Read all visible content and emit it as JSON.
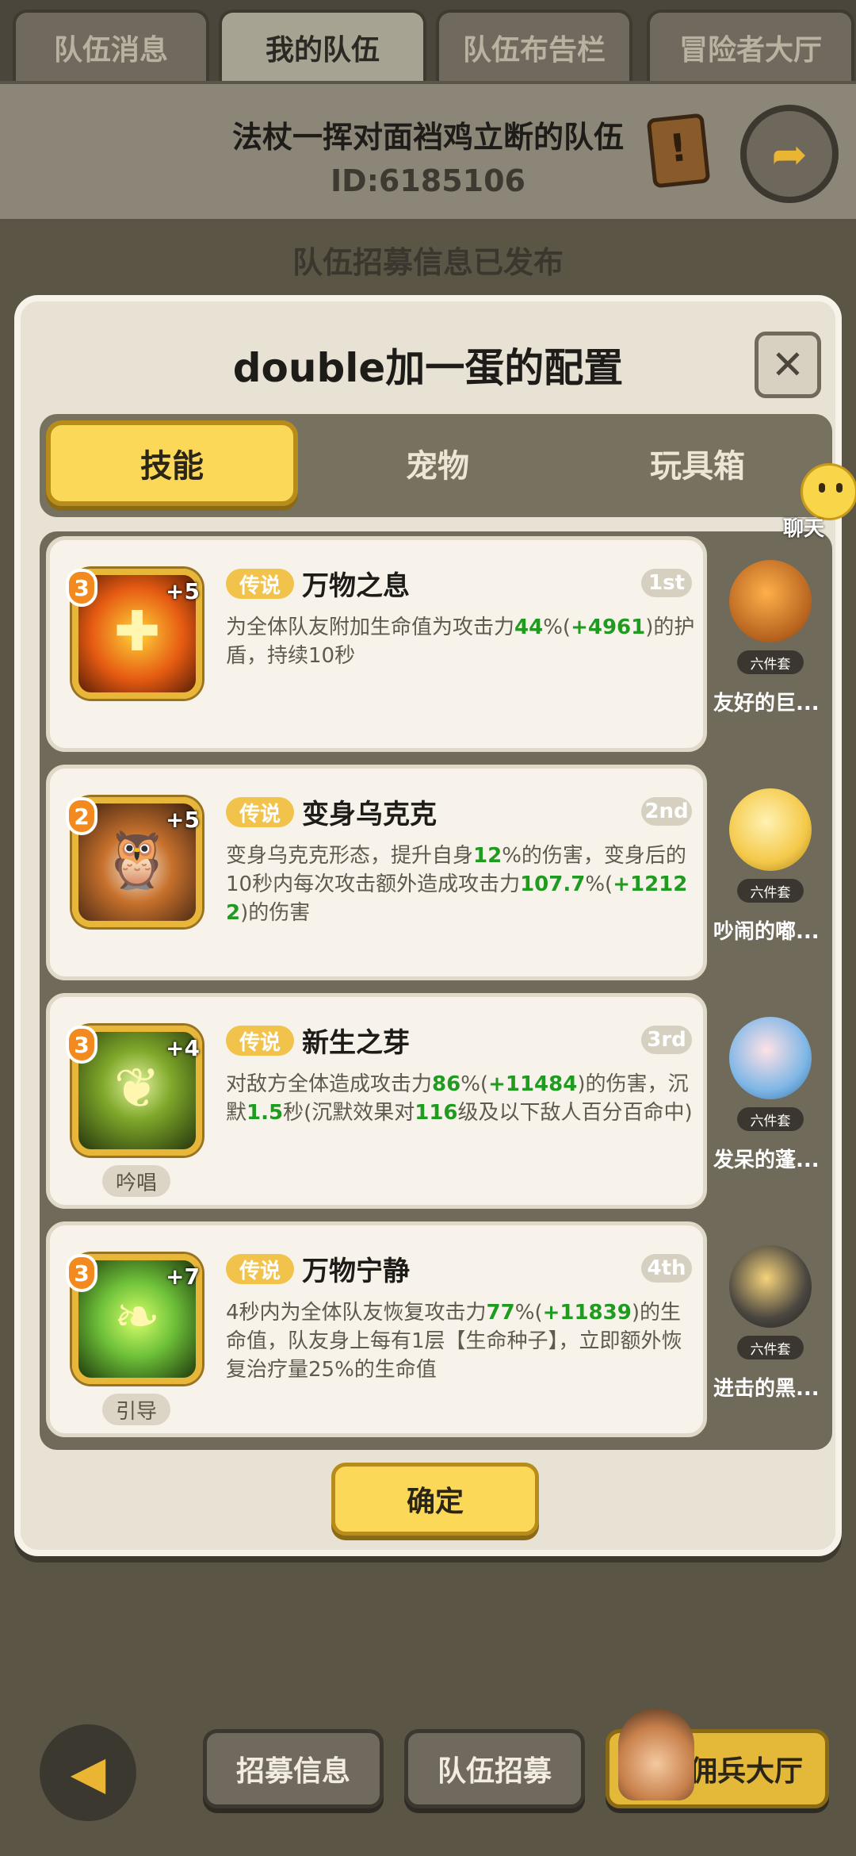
{
  "top_tabs": [
    "队伍消息",
    "我的队伍",
    "队伍布告栏",
    "冒险者大厅"
  ],
  "team": {
    "name": "法杖一挥对面裆鸡立断的队伍",
    "id": "ID:6185106"
  },
  "recruit_status": "队伍招募信息已发布",
  "modal": {
    "title": "double加一蛋的配置",
    "close_symbol": "✕",
    "tabs": [
      "技能",
      "宠物",
      "玩具箱"
    ],
    "active_tab": "技能",
    "confirm_label": "确定"
  },
  "skills": [
    {
      "rarity": "传说",
      "name": "万物之息",
      "rank": "1st",
      "level": "3",
      "plus": "+5",
      "tag": "",
      "desc": [
        {
          "t": "为全体队友附加生命值为攻击力"
        },
        {
          "t": "44",
          "g": true
        },
        {
          "t": "%("
        },
        {
          "t": "+4961",
          "g": true
        },
        {
          "t": ")的护盾，持续10秒"
        }
      ]
    },
    {
      "rarity": "传说",
      "name": "变身乌克克",
      "rank": "2nd",
      "level": "2",
      "plus": "+5",
      "tag": "",
      "desc": [
        {
          "t": "变身乌克克形态，提升自身"
        },
        {
          "t": "12",
          "g": true
        },
        {
          "t": "%的伤害，变身后的10秒内每次攻击额外造成攻击力"
        },
        {
          "t": "107.7",
          "g": true
        },
        {
          "t": "%("
        },
        {
          "t": "+12122",
          "g": true
        },
        {
          "t": ")的伤害"
        }
      ]
    },
    {
      "rarity": "传说",
      "name": "新生之芽",
      "rank": "3rd",
      "level": "3",
      "plus": "+4",
      "tag": "吟唱",
      "desc": [
        {
          "t": "对敌方全体造成攻击力"
        },
        {
          "t": "86",
          "g": true
        },
        {
          "t": "%("
        },
        {
          "t": "+11484",
          "g": true
        },
        {
          "t": ")的伤害，沉默"
        },
        {
          "t": "1.5",
          "g": true
        },
        {
          "t": "秒(沉默效果对"
        },
        {
          "t": "116",
          "g": true
        },
        {
          "t": "级及以下敌人百分百命中)"
        }
      ]
    },
    {
      "rarity": "传说",
      "name": "万物宁静",
      "rank": "4th",
      "level": "3",
      "plus": "+7",
      "tag": "引导",
      "desc": [
        {
          "t": "4秒内为全体队友恢复攻击力"
        },
        {
          "t": "77",
          "g": true
        },
        {
          "t": "%("
        },
        {
          "t": "+11839",
          "g": true
        },
        {
          "t": ")的生命值，队友身上每有1层【生命种子】，立即额外恢复治疗量25%的生命值"
        }
      ]
    }
  ],
  "pets": [
    {
      "name": "友好的巨...",
      "set_tag": "六件套"
    },
    {
      "name": "吵闹的嘟...",
      "set_tag": "六件套"
    },
    {
      "name": "发呆的蓬...",
      "set_tag": "六件套"
    },
    {
      "name": "进击的黑...",
      "set_tag": "六件套"
    }
  ],
  "chat_label": "聊天",
  "bottom_bar": {
    "back_symbol": "◀",
    "buttons": [
      "招募信息",
      "队伍招募",
      "佣兵大厅"
    ]
  },
  "colors": {
    "accent_yellow": "#fbd858",
    "value_green": "#1f9b1f",
    "level_orange": "#f28a1f"
  }
}
